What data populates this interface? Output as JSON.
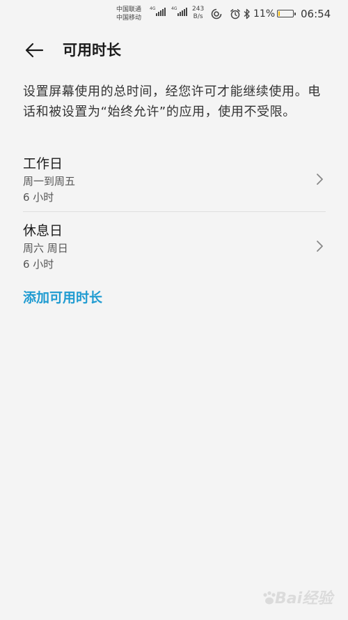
{
  "status_bar": {
    "carrier_1": "中国联通",
    "carrier_2": "中国移动",
    "network_tag_1": "4G",
    "network_tag_2": "4G",
    "speed_value": "243",
    "speed_unit": "B/s",
    "battery_percent": "11%",
    "battery_level": 0.11,
    "time": "06:54"
  },
  "app_bar": {
    "title": "可用时长"
  },
  "description": "设置屏幕使用的总时间，经您许可才能继续使用。电话和被设置为“始终允许”的应用，使用不受限。",
  "schedules": [
    {
      "title": "工作日",
      "days": "周一到周五",
      "hours": "6 小时"
    },
    {
      "title": "休息日",
      "days": "周六 周日",
      "hours": "6 小时"
    }
  ],
  "add_label": "添加可用时长",
  "colors": {
    "accent": "#1f9bd1",
    "background": "#f4f4f4",
    "battery_low": "#f2b705"
  }
}
